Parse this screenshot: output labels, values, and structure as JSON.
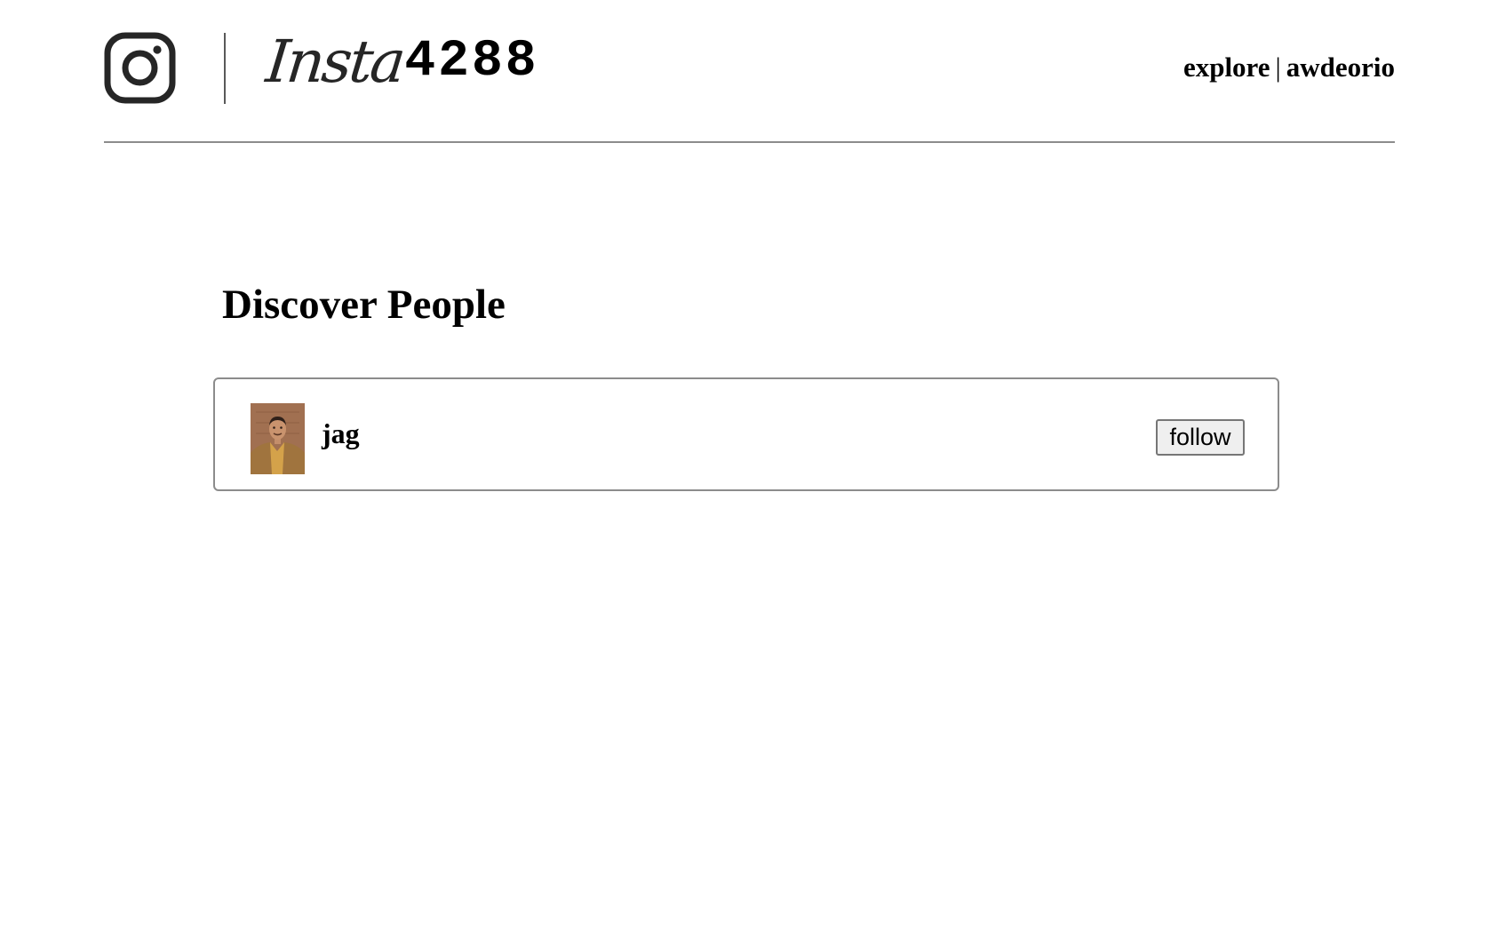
{
  "header": {
    "brand_script": "Insta",
    "brand_number": "4288",
    "nav": {
      "explore_label": "explore",
      "separator": "|",
      "username_label": "awdeorio"
    }
  },
  "main": {
    "title": "Discover People",
    "users": [
      {
        "username": "jag",
        "action_label": "follow"
      }
    ]
  },
  "colors": {
    "divider": "#8c8c8c",
    "button_bg": "#efefef",
    "text": "#000000"
  },
  "icons": [
    "instagram-camera-icon"
  ]
}
